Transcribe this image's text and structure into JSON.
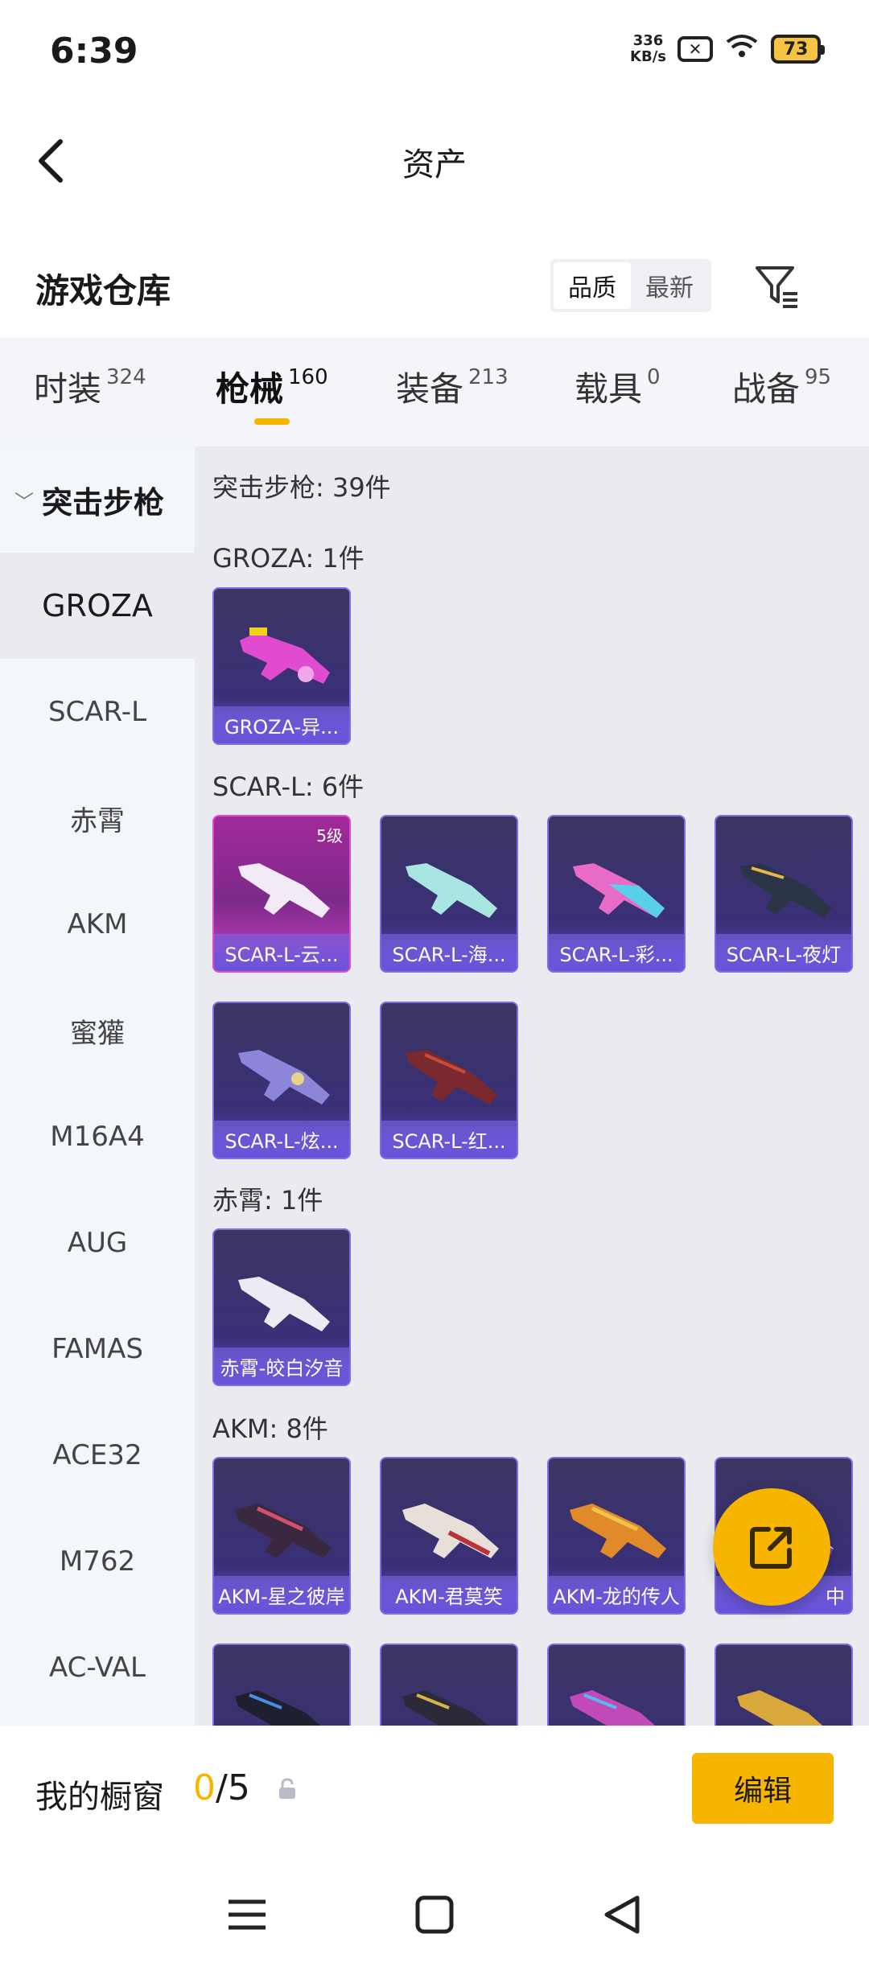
{
  "status_bar": {
    "time": "6:39",
    "net_speed_value": "336",
    "net_speed_unit": "KB/s",
    "battery": "73",
    "signal_sub": "6"
  },
  "header": {
    "title": "资产"
  },
  "warehouse": {
    "title": "游戏仓库",
    "sort_options": [
      "品质",
      "最新"
    ],
    "sort_active": "品质"
  },
  "tabs": [
    {
      "label": "时装",
      "count": "324"
    },
    {
      "label": "枪械",
      "count": "160"
    },
    {
      "label": "装备",
      "count": "213"
    },
    {
      "label": "载具",
      "count": "0"
    },
    {
      "label": "战备",
      "count": "95"
    }
  ],
  "sidebar": {
    "group": "突击步枪",
    "items": [
      "GROZA",
      "SCAR-L",
      "赤霄",
      "AKM",
      "蜜獾",
      "M16A4",
      "AUG",
      "FAMAS",
      "ACE32",
      "M762",
      "AC-VAL"
    ],
    "active": "GROZA"
  },
  "content": {
    "summary": "突击步枪: 39件",
    "sections": [
      {
        "heading": "GROZA: 1件",
        "items": [
          {
            "label": "GROZA-异..."
          }
        ]
      },
      {
        "heading": "SCAR-L: 6件",
        "items": [
          {
            "label": "SCAR-L-云...",
            "level": "5级"
          },
          {
            "label": "SCAR-L-海..."
          },
          {
            "label": "SCAR-L-彩..."
          },
          {
            "label": "SCAR-L-夜灯"
          },
          {
            "label": "SCAR-L-炫..."
          },
          {
            "label": "SCAR-L-红..."
          }
        ]
      },
      {
        "heading": "赤霄: 1件",
        "items": [
          {
            "label": "赤霄-皎白汐音"
          }
        ]
      },
      {
        "heading": "AKM: 8件",
        "items": [
          {
            "label": "AKM-星之彼岸"
          },
          {
            "label": "AKM-君莫笑"
          },
          {
            "label": "AKM-龙的传人"
          },
          {
            "label": "中"
          }
        ]
      }
    ]
  },
  "showcase": {
    "label": "我的橱窗",
    "current": "0",
    "total": "/5",
    "edit_label": "编辑"
  },
  "colors": {
    "accent": "#f7b500",
    "card_purple": "#3a2f78",
    "card_pink": "#a22a9a"
  }
}
